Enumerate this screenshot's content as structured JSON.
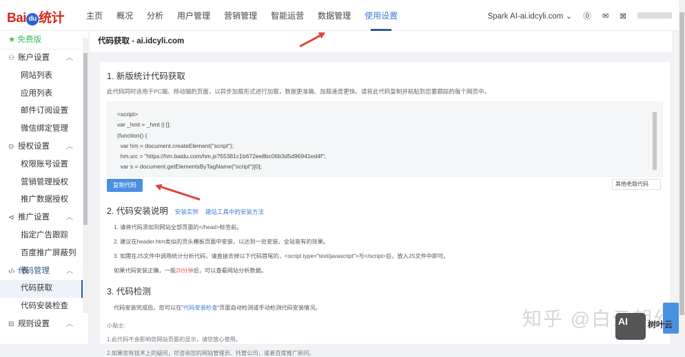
{
  "header": {
    "logo": "Bai du 统计",
    "logo_du": "du",
    "nav": [
      "主页",
      "概况",
      "分析",
      "用户管理",
      "营销管理",
      "智能运营",
      "数据管理",
      "使用设置"
    ],
    "account": "Spark AI-ai.idcyli.com"
  },
  "sidebar": {
    "free": "免费版",
    "groups": [
      {
        "label": "账户设置",
        "icon": "user-icon",
        "items": [
          "网站列表",
          "应用列表",
          "邮件订阅设置",
          "微信绑定管理"
        ]
      },
      {
        "label": "授权设置",
        "icon": "shield-icon",
        "items": [
          "权限账号设置",
          "营销管理授权",
          "推广数据授权"
        ]
      },
      {
        "label": "推广设置",
        "icon": "megaphone-icon",
        "items": [
          "指定广告跟踪",
          "百度推广屏蔽列表"
        ]
      },
      {
        "label": "代码管理",
        "icon": "code-icon",
        "items": [
          "代码获取",
          "代码安装检查"
        ]
      },
      {
        "label": "规则设置",
        "icon": "rule-icon",
        "items": []
      }
    ]
  },
  "page": {
    "title": "代码获取 - ai.idcyli.com",
    "s1_title": "1. 新版统计代码获取",
    "s1_desc": "此代码同时适用于PC端、移动端的页面，以异步加载形式进行加载，数据更准确、加载速度更快。请将此代码复制并粘贴到您要跟踪的每个网页中。",
    "code": [
      "<script>",
      "var _hmt = _hmt || [];",
      "(function() {",
      "  var hm = document.createElement(\"script\");",
      "  hm.src = \"https://hm.baidu.com/hm.js?55381c1b672ee8bc06b3d5d96941ed4f\";",
      "  var s = document.getElementsByTagName(\"script\")[0];"
    ],
    "copy_btn": "复制代码",
    "old_btn": "其他老版代码",
    "s2_title": "2. 代码安装说明",
    "s2_link1": "安装实例",
    "s2_link2": "建站工具中的安装方法",
    "s2_items": [
      "1. 请将代码添加到网站全部页面的</head>标签前。",
      "2. 建议在header.htm类似的页头模板页面中安装，以达到一处安装，全站皆有的效果。",
      "3. 如需在JS文件中调用统计分析代码，请直接去掉以下代码首尾的，<script type=\"text/javascript\">与</script>后，放入JS文件中即可。"
    ],
    "s2_note_a": "如果代码安装正确，一般",
    "s2_note_red": "20分钟",
    "s2_note_b": "后，可以查看网站分析数据。",
    "s3_title": "3. 代码检测",
    "s3_a": "代码安装完成后，您可以在\"",
    "s3_link": "代码安装检查",
    "s3_b": "\"页面自动检测或手动检测代码安装情况。",
    "tips_title": "小贴士:",
    "tips": [
      "1.此代码不会影响您网站页面的显示，请您放心使用。",
      "2.如果您有技术上的疑问，可咨询您的网站管理员、托管公司，或者百度推广顾问。"
    ]
  },
  "watermark": "知乎 @白云朝幻",
  "brand": "树叶云",
  "brand_logo": "AI"
}
